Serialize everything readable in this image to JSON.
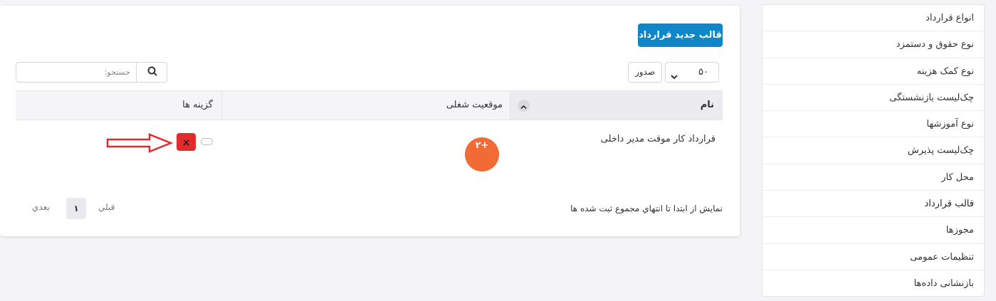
{
  "sidebar": {
    "items": [
      {
        "label": "انواع قرارداد"
      },
      {
        "label": "نوع حقوق و دستمزد"
      },
      {
        "label": "نوع کمک هزینه"
      },
      {
        "label": "چک‌لیست بازنشستگی"
      },
      {
        "label": "نوع آموزشها"
      },
      {
        "label": "چک‌لیست پذیرش"
      },
      {
        "label": "محل کار"
      },
      {
        "label": "قالب قرارداد"
      },
      {
        "label": "مجوزها"
      },
      {
        "label": "تنظیمات عمومی"
      },
      {
        "label": "بازنشانی داده‌ها"
      }
    ],
    "active_index": 7
  },
  "toolbar": {
    "new_button_label": "قالب جدید قرارداد",
    "page_size_value": "۵۰",
    "export_label": "صدور",
    "search_placeholder": "جستجو:"
  },
  "table": {
    "columns": [
      "نام",
      "موقعیت شغلی",
      "گزینه ها"
    ],
    "rows": [
      {
        "name": "قرارداد کار موقت مدیر داخلی",
        "position": "",
        "options": ""
      }
    ]
  },
  "badge": {
    "label": "۲+"
  },
  "footer": {
    "summary": "نمایش از ابتدا تا انتهاي مجموع ثبت شده ها",
    "prev_label": "قبلي",
    "current_page": "۱",
    "next_label": "بعدي"
  },
  "colors": {
    "primary": "#0f86c7",
    "danger": "#e02c2c",
    "badge": "#f26a35",
    "annotation_arrow": "#e02c2c"
  }
}
